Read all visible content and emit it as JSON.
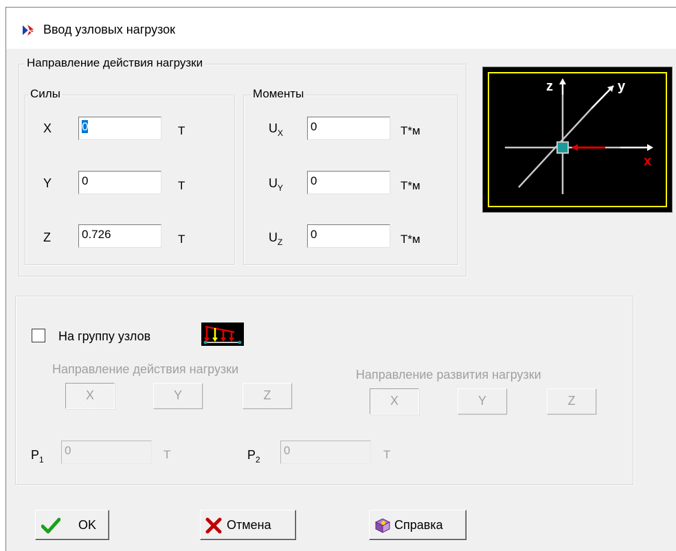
{
  "window": {
    "title": "Ввод узловых нагрузок",
    "icon": "app-logo-icon"
  },
  "direction_group": {
    "legend": "Направление действия нагрузки",
    "forces": {
      "legend": "Силы",
      "rows": [
        {
          "label": "X",
          "value": "0",
          "unit": "Т"
        },
        {
          "label": "Y",
          "value": "0",
          "unit": "Т"
        },
        {
          "label": "Z",
          "value": "0.726",
          "unit": "Т"
        }
      ]
    },
    "moments": {
      "legend": "Моменты",
      "rows": [
        {
          "label": "U",
          "sub": "X",
          "value": "0",
          "unit": "Т*м"
        },
        {
          "label": "U",
          "sub": "Y",
          "value": "0",
          "unit": "Т*м"
        },
        {
          "label": "U",
          "sub": "Z",
          "value": "0",
          "unit": "Т*м"
        }
      ]
    }
  },
  "axes_preview": {
    "z_label": "z",
    "y_label": "y",
    "x_label": "x",
    "node_color": "#1a9a9a",
    "x_color": "#e00000",
    "frame_color": "#ffff00"
  },
  "group_section": {
    "checkbox_label": "На группу узлов",
    "checked": false,
    "icon": "load-distribution-icon",
    "load_direction": {
      "title": "Направление действия нагрузки",
      "buttons": [
        "X",
        "Y",
        "Z"
      ],
      "selected": "X"
    },
    "spread_direction": {
      "title": "Направление развития нагрузки",
      "buttons": [
        "X",
        "Y",
        "Z"
      ],
      "selected": "X"
    },
    "p1": {
      "label": "P",
      "sub": "1",
      "value": "0",
      "unit": "Т"
    },
    "p2": {
      "label": "P",
      "sub": "2",
      "value": "0",
      "unit": "Т"
    }
  },
  "buttons": {
    "ok": "OK",
    "cancel": "Отмена",
    "help": "Справка"
  }
}
